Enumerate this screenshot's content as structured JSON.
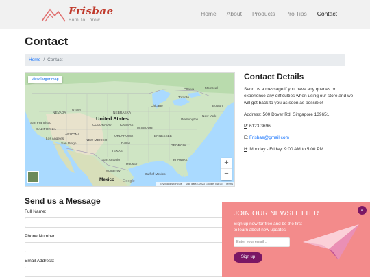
{
  "brand": {
    "name": "Frisbae",
    "tagline": "Born To Throw",
    "logo_icon": "mountain-logo-icon"
  },
  "nav": [
    {
      "label": "Home",
      "active": false
    },
    {
      "label": "About",
      "active": false
    },
    {
      "label": "Products",
      "active": false
    },
    {
      "label": "Pro Tips",
      "active": false
    },
    {
      "label": "Contact",
      "active": true
    }
  ],
  "page": {
    "title": "Contact"
  },
  "breadcrumb": {
    "home": "Home",
    "separator": "/",
    "current": "Contact"
  },
  "map": {
    "view_larger": "View larger map",
    "zoom_in": "+",
    "zoom_out": "−",
    "provider": "Google",
    "footer": {
      "shortcuts": "Keyboard shortcuts",
      "data": "Map data ©2023 Google, INEGI",
      "terms": "Terms"
    },
    "labels": {
      "country_us": "United States",
      "country_mx": "Mexico",
      "ottawa": "Ottawa",
      "montreal": "Montreal",
      "toronto": "Toronto",
      "chicago": "Chicago",
      "boston": "Boston",
      "new_york": "New York",
      "washington": "Washington",
      "san_francisco": "San Francisco",
      "los_angeles": "Los Angeles",
      "san_diego": "San Diego",
      "dallas": "Dallas",
      "houston": "Houston",
      "san_antonio": "San Antonio",
      "monterrey": "Monterrey",
      "gulf": "Gulf of Mexico",
      "nevada": "NEVADA",
      "utah": "UTAH",
      "colorado": "COLORADO",
      "kansas": "KANSAS",
      "oklahoma": "OKLAHOMA",
      "texas": "TEXAS",
      "new_mexico": "NEW MEXICO",
      "arizona": "ARIZONA",
      "california": "CALIFORNIA",
      "nebraska": "NEBRASKA",
      "missouri": "MISSOURI",
      "tennessee": "TENNESSEE",
      "georgia": "GEORGIA",
      "florida": "FLORIDA"
    }
  },
  "contact": {
    "heading": "Contact Details",
    "intro": "Send us a message if you have any queries or experience any difficulties when using our store and we will get back to you as soon as possible!",
    "address_label": "Address: 500 Dover Rd, Singapore 139651",
    "phone_prefix": "P",
    "phone": ": 6123 3696",
    "email_prefix": "E",
    "email": "Frisbae@gmail.com",
    "hours_prefix": "H",
    "hours": ": Monday - Friday: 9:00 AM to 5:00 PM"
  },
  "form": {
    "title": "Send us a Message",
    "full_name_label": "Full Name:",
    "phone_label": "Phone Number:",
    "email_label": "Email Address:"
  },
  "newsletter": {
    "title": "JOIN OUR NEWSLETTER",
    "text": "Sign up now for free and be the first to learn about new updates",
    "email_placeholder": "Enter your email...",
    "button": "Sign up",
    "close": "×",
    "colors": {
      "background": "#f38b8b",
      "accent": "#7a1664"
    }
  }
}
